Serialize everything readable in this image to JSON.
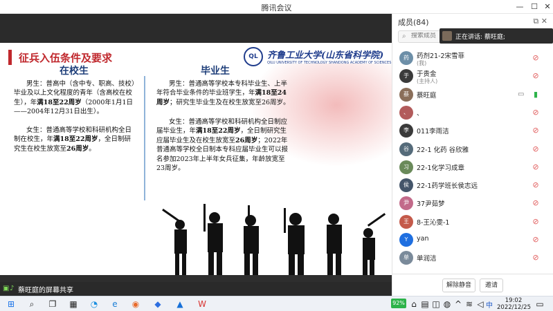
{
  "window": {
    "title": "腾讯会议"
  },
  "slide": {
    "title": "征兵入伍条件及要求",
    "logo_cn": "齐鲁工业大学(山东省科学院)",
    "logo_en": "QILU UNIVERSITY OF TECHNOLOGY    SHANDONG ACADEMY OF SCIENCES",
    "left_heading": "在校生",
    "right_heading": "毕业生",
    "left_p1_a": "男生：普高中（含中专、职高、技校）毕业及以上文化程度的青年（含高校在校生），年",
    "left_p1_b": "满18至22周岁",
    "left_p1_c": "（2000年1月1日——2004年12月31日出生）。",
    "left_p2_a": "女生：普通高等学校和科研机构全日制在校生，年",
    "left_p2_b": "满18至22周岁",
    "left_p2_c": "，全日制研究生在校生放宽至",
    "left_p2_d": "26周岁",
    "left_p2_e": "。",
    "right_p1_a": "男生：普通高等学校本专科毕业生、上半年符合毕业条件的毕业班学生，年",
    "right_p1_b": "满18至24周岁",
    "right_p1_c": "；研究生毕业生及在校生放宽至26周岁。",
    "right_p2_a": "女生：普通高等学校和科研机构全日制应届毕业生，年",
    "right_p2_b": "满18至22周岁",
    "right_p2_c": "，全日制研究生应届毕业生及在校生放宽至",
    "right_p2_d": "26周岁",
    "right_p2_e": "；2022年普通高等学校全日制本专科应届毕业生可以报名参加2023年上半年女兵征集，年龄放宽至23周岁。"
  },
  "presenter": {
    "text": "蔡旺庭的屏幕共享"
  },
  "panel": {
    "header": "成员(84)",
    "search_placeholder": "搜索成员",
    "speaking": "正在讲话: 蔡旺庭;",
    "members": [
      {
        "name": "药剂21-2宋雪菲",
        "sub": "(我)",
        "avatar": "药",
        "color": "#6d8fa8"
      },
      {
        "name": "于贵金",
        "sub": "(主持人)",
        "avatar": "于",
        "color": "#3b3b3b"
      },
      {
        "name": "蔡旺庭",
        "sub": "",
        "avatar": "蔡",
        "color": "#8a6f5a"
      },
      {
        "name": "、",
        "sub": "",
        "avatar": "、",
        "color": "#b25b5b"
      },
      {
        "name": "011李雨洁",
        "sub": "",
        "avatar": "李",
        "color": "#3a3a3a"
      },
      {
        "name": "22-1 化药 谷欣雅",
        "sub": "",
        "avatar": "谷",
        "color": "#556b7a"
      },
      {
        "name": "22-1化学习成章",
        "sub": "",
        "avatar": "习",
        "color": "#6a8a5a"
      },
      {
        "name": "22-1药学班长侯志远",
        "sub": "",
        "avatar": "侯",
        "color": "#44556a"
      },
      {
        "name": "37尹茹梦",
        "sub": "",
        "avatar": "尹",
        "color": "#c26a8a"
      },
      {
        "name": "8-王沁雯-1",
        "sub": "",
        "avatar": "王",
        "color": "#c45a4a"
      },
      {
        "name": "yan",
        "sub": "",
        "avatar": "Y",
        "color": "#1f6fe0"
      },
      {
        "name": "单润洁",
        "sub": "",
        "avatar": "单",
        "color": "#7a8a9a"
      }
    ],
    "mute_all": "解除静音",
    "invite": "邀请"
  },
  "taskbar": {
    "battery": "92%",
    "time": "19:02",
    "date": "2022/12/25",
    "ime": "中"
  }
}
